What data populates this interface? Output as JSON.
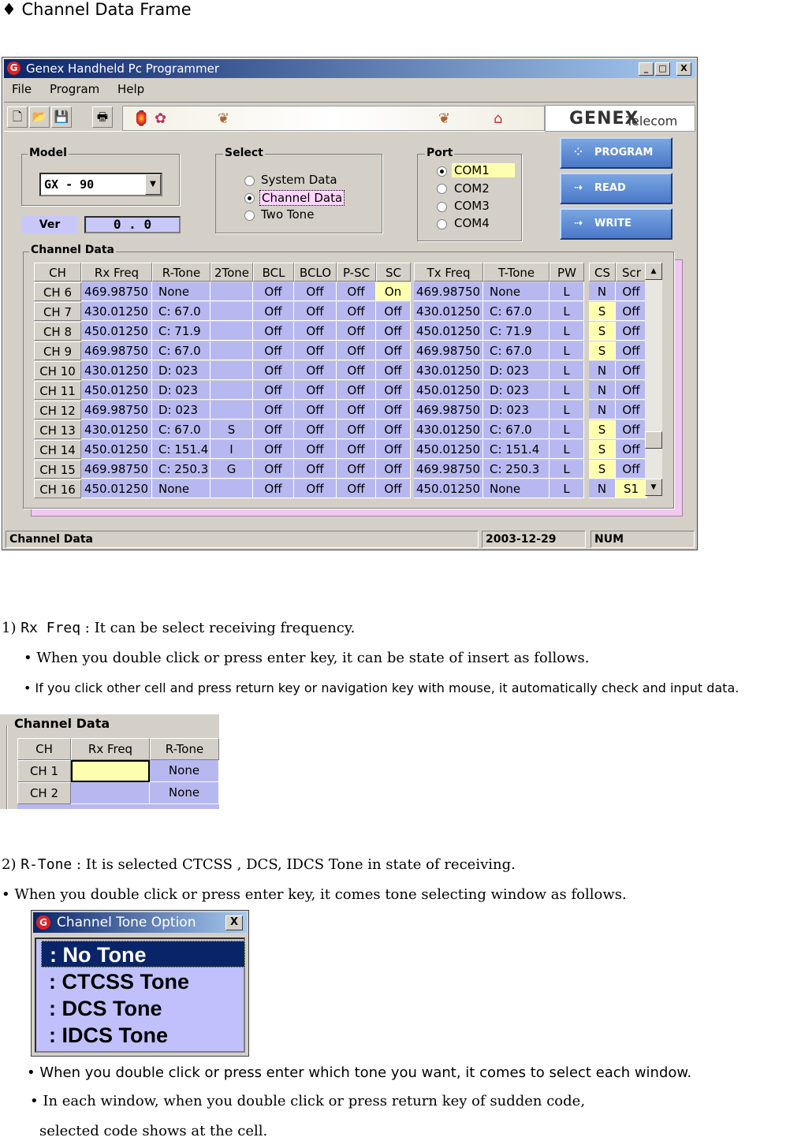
{
  "heading": "♦ Channel Data Frame",
  "window": {
    "title": "Genex Handheld Pc Programmer",
    "app_icon": "G",
    "caption_buttons": [
      "_",
      "□",
      "X"
    ],
    "menu": [
      "File",
      "Program",
      "Help"
    ],
    "logo_main": "GENEX",
    "logo_sub": "Telecom",
    "model": {
      "label": "Model",
      "value": "GX - 90"
    },
    "ver": {
      "label": "Ver",
      "value": "0 . 0"
    },
    "select": {
      "label": "Select",
      "options": [
        "System Data",
        "Channel Data",
        "Two Tone"
      ],
      "selected": 1
    },
    "port": {
      "label": "Port",
      "options": [
        "COM1",
        "COM2",
        "COM3",
        "COM4"
      ],
      "selected": 0
    },
    "actions": [
      "PROGRAM",
      "READ",
      "WRITE"
    ],
    "grid_title": "Channel Data",
    "columns": [
      "CH",
      "Rx Freq",
      "R-Tone",
      "2Tone",
      "BCL",
      "BCLO",
      "P-SC",
      "SC",
      "Tx Freq",
      "T-Tone",
      "PW",
      "CS",
      "Scr"
    ],
    "rows": [
      [
        "CH  6",
        "469.98750",
        "None",
        "",
        "Off",
        "Off",
        "Off",
        "On",
        "469.98750",
        "None",
        "L",
        "N",
        "Off"
      ],
      [
        "CH  7",
        "430.01250",
        "C: 67.0",
        "",
        "Off",
        "Off",
        "Off",
        "Off",
        "430.01250",
        "C: 67.0",
        "L",
        "S",
        "Off"
      ],
      [
        "CH  8",
        "450.01250",
        "C: 71.9",
        "",
        "Off",
        "Off",
        "Off",
        "Off",
        "450.01250",
        "C: 71.9",
        "L",
        "S",
        "Off"
      ],
      [
        "CH  9",
        "469.98750",
        "C: 67.0",
        "",
        "Off",
        "Off",
        "Off",
        "Off",
        "469.98750",
        "C: 67.0",
        "L",
        "S",
        "Off"
      ],
      [
        "CH 10",
        "430.01250",
        "D: 023",
        "",
        "Off",
        "Off",
        "Off",
        "Off",
        "430.01250",
        "D: 023",
        "L",
        "N",
        "Off"
      ],
      [
        "CH 11",
        "450.01250",
        "D: 023",
        "",
        "Off",
        "Off",
        "Off",
        "Off",
        "450.01250",
        "D: 023",
        "L",
        "N",
        "Off"
      ],
      [
        "CH 12",
        "469.98750",
        "D: 023",
        "",
        "Off",
        "Off",
        "Off",
        "Off",
        "469.98750",
        "D: 023",
        "L",
        "N",
        "Off"
      ],
      [
        "CH 13",
        "430.01250",
        "C: 67.0",
        "S",
        "Off",
        "Off",
        "Off",
        "Off",
        "430.01250",
        "C: 67.0",
        "L",
        "S",
        "Off"
      ],
      [
        "CH 14",
        "450.01250",
        "C: 151.4",
        "I",
        "Off",
        "Off",
        "Off",
        "Off",
        "450.01250",
        "C: 151.4",
        "L",
        "S",
        "Off"
      ],
      [
        "CH 15",
        "469.98750",
        "C: 250.3",
        "G",
        "Off",
        "Off",
        "Off",
        "Off",
        "469.98750",
        "C: 250.3",
        "L",
        "S",
        "Off"
      ],
      [
        "CH 16",
        "450.01250",
        "None",
        "",
        "Off",
        "Off",
        "Off",
        "Off",
        "450.01250",
        "None",
        "L",
        "N",
        "S1"
      ]
    ],
    "status": [
      "Channel Data",
      "2003-12-29",
      "NUM"
    ]
  },
  "section1": {
    "num": "1)",
    "term": "Rx Freq",
    "desc": " : It can be select receiving frequency.",
    "bullet1": "• When you double click or press enter key, it can be state of insert as follows.",
    "bullet2": "• If you click other cell and press return key or navigation key with mouse, it automatically check and input data."
  },
  "snippet1": {
    "title": "Channel Data",
    "columns": [
      "CH",
      "Rx Freq",
      "R-Tone"
    ],
    "rows": [
      [
        "CH  1",
        "",
        "None"
      ],
      [
        "CH  2",
        "",
        "None"
      ]
    ]
  },
  "section2": {
    "num": "2)",
    "term": "R-Tone",
    "desc": " : It is selected CTCSS , DCS, IDCS Tone in state of receiving.",
    "bullet1": "• When you double click or press enter key, it comes tone selecting window as follows.",
    "bullet2": "• When you double click or press enter which tone you want, it comes to select each window.",
    "bullet3": "• In each window, when you double click or press return key of sudden code,",
    "bullet3b": "selected code shows at the cell."
  },
  "tone_dialog": {
    "title": "Channel Tone Option",
    "close": "X",
    "options": [
      ": No Tone",
      ": CTCSS Tone",
      ": DCS Tone",
      ": IDCS Tone"
    ]
  }
}
